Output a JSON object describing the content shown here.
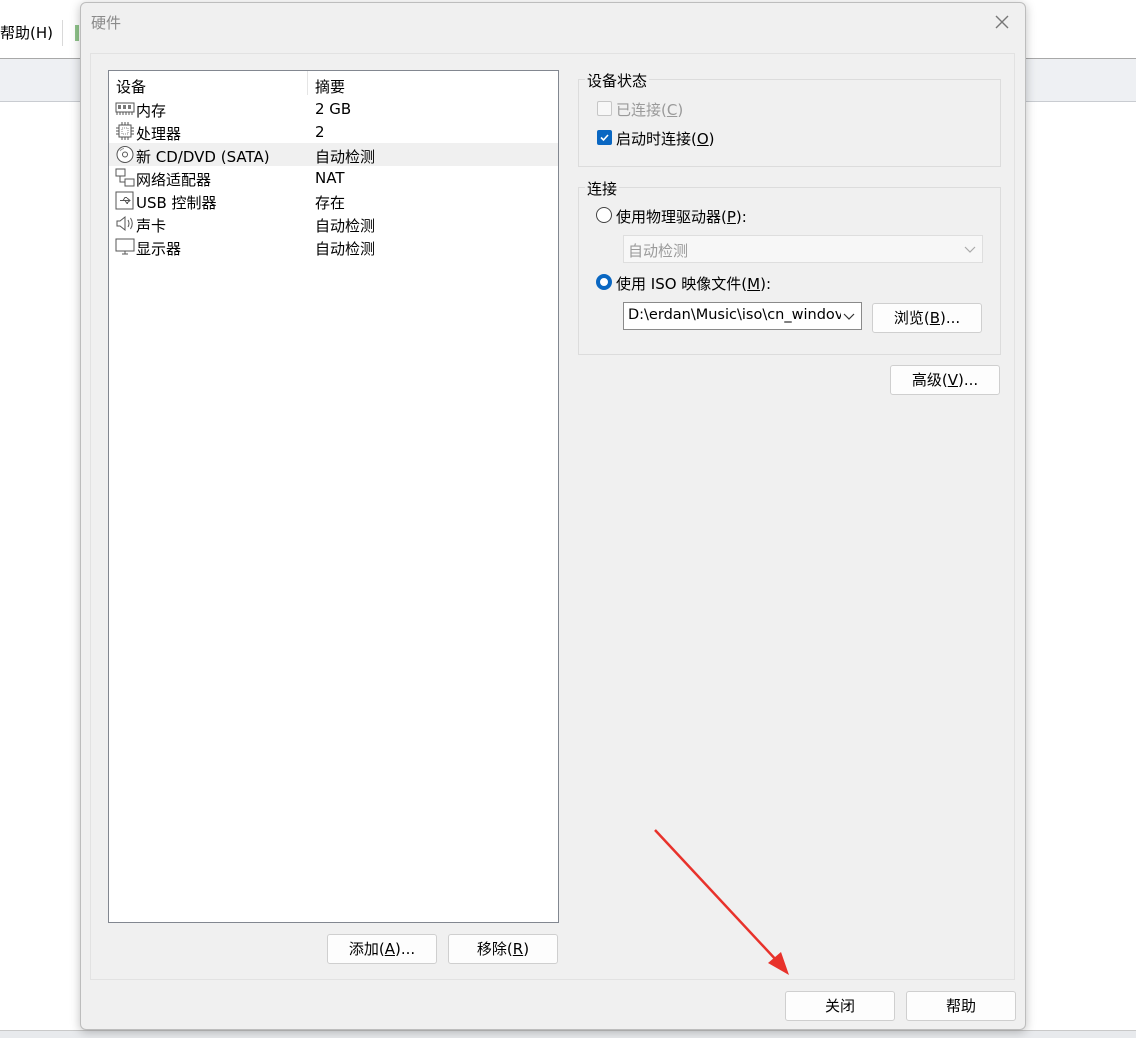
{
  "background_app": {
    "help_menu_label": "帮助(H)"
  },
  "dialog": {
    "title": "硬件",
    "device_list": {
      "columns": [
        "设备",
        "摘要"
      ],
      "rows": [
        {
          "icon": "memory-icon",
          "name": "内存",
          "summary": "2 GB"
        },
        {
          "icon": "processor-icon",
          "name": "处理器",
          "summary": "2"
        },
        {
          "icon": "cd-dvd-icon",
          "name": "新 CD/DVD (SATA)",
          "summary": "自动检测",
          "selected": true
        },
        {
          "icon": "network-adapter-icon",
          "name": "网络适配器",
          "summary": "NAT"
        },
        {
          "icon": "usb-controller-icon",
          "name": "USB 控制器",
          "summary": "存在"
        },
        {
          "icon": "sound-card-icon",
          "name": "声卡",
          "summary": "自动检测"
        },
        {
          "icon": "display-icon",
          "name": "显示器",
          "summary": "自动检测"
        }
      ]
    },
    "add_button": {
      "text": "添加(",
      "key": "A",
      "suffix": ")..."
    },
    "remove_button": {
      "text": "移除(",
      "key": "R",
      "suffix": ")"
    },
    "device_status": {
      "title": "设备状态",
      "connected": {
        "text": "已连接(",
        "key": "C",
        "suffix": ")",
        "checked": false,
        "enabled": false
      },
      "connect_at_power_on": {
        "text": "启动时连接(",
        "key": "O",
        "suffix": ")",
        "checked": true
      }
    },
    "connection": {
      "title": "连接",
      "physical_drive": {
        "text": "使用物理驱动器(",
        "key": "P",
        "suffix": "):",
        "selected": false
      },
      "physical_drive_select": "自动检测",
      "iso_file": {
        "text": "使用 ISO 映像文件(",
        "key": "M",
        "suffix": "):",
        "selected": true
      },
      "iso_path": "D:\\erdan\\Music\\iso\\cn_windov",
      "browse_button": {
        "text": "浏览(",
        "key": "B",
        "suffix": ")..."
      }
    },
    "advanced_button": {
      "text": "高级(",
      "key": "V",
      "suffix": ")..."
    },
    "close_button": "关闭",
    "help_button": "帮助"
  },
  "colors": {
    "accent": "#0a67c2",
    "annotation_arrow": "#e8322b"
  }
}
